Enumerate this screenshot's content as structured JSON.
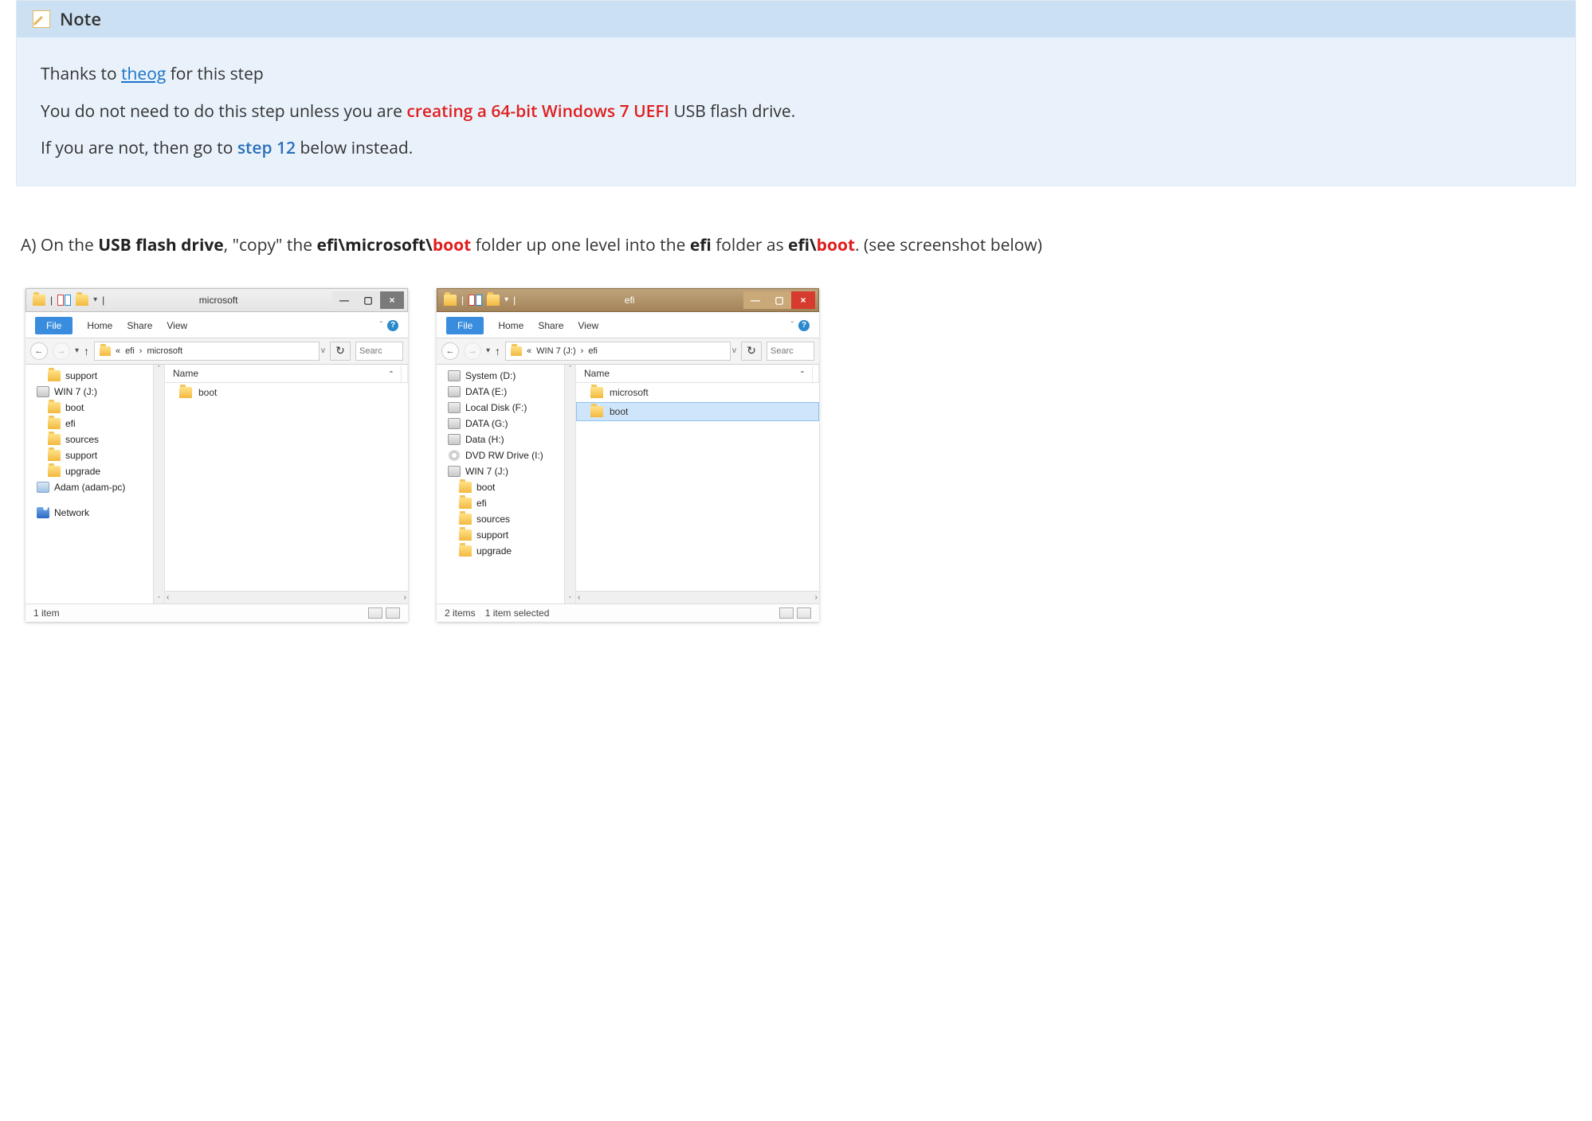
{
  "note": {
    "heading": "Note",
    "thanks_prefix": "Thanks to ",
    "thanks_link": "theog",
    "thanks_suffix": " for this step",
    "line2_pre": "You do not need to do this step unless you are ",
    "line2_emph": "creating a 64-bit Windows 7 UEFI",
    "line2_post": " USB flash drive.",
    "line3_pre": "If you are not, then go to ",
    "line3_step": "step 12",
    "line3_post": " below instead."
  },
  "instruction": {
    "pre": "A) On the ",
    "b1": "USB flash drive",
    "mid1": ", \"copy\" the ",
    "b2": "efi\\microsoft\\",
    "red1": "boot",
    "mid2": " folder up one level into the ",
    "b3": "efi",
    "mid3": " folder as ",
    "b4": "efi\\",
    "red2": "boot",
    "post": ". (see screenshot below)"
  },
  "left": {
    "title": "microsoft",
    "tabs": {
      "file": "File",
      "home": "Home",
      "share": "Share",
      "view": "View"
    },
    "breadcrumb": [
      "«",
      "efi",
      "›",
      "microsoft"
    ],
    "search": "Searc",
    "nav": [
      "support",
      "WIN 7 (J:)",
      "boot",
      "efi",
      "sources",
      "support",
      "upgrade",
      "Adam (adam-pc)",
      "",
      "Network"
    ],
    "col_name": "Name",
    "items": [
      "boot"
    ],
    "status": "1 item"
  },
  "right": {
    "title": "efi",
    "tabs": {
      "file": "File",
      "home": "Home",
      "share": "Share",
      "view": "View"
    },
    "breadcrumb": [
      "«",
      "WIN 7 (J:)",
      "›",
      "efi"
    ],
    "search": "Searc",
    "nav": [
      "System (D:)",
      "DATA (E:)",
      "Local Disk (F:)",
      "DATA (G:)",
      "Data (H:)",
      "DVD RW Drive (I:)",
      "WIN 7 (J:)",
      "boot",
      "efi",
      "sources",
      "support",
      "upgrade"
    ],
    "col_name": "Name",
    "items": [
      "microsoft",
      "boot"
    ],
    "status_count": "2 items",
    "status_sel": "1 item selected"
  },
  "glyphs": {
    "min": "—",
    "max": "▢",
    "close": "×",
    "back": "←",
    "forward": "→",
    "up": "↑",
    "caret": "▾",
    "refresh": "↻",
    "chev_r": "›",
    "chev_l": "‹",
    "chev_up": "ˆ",
    "chev_dn": "ˇ",
    "help": "?",
    "pipe": "|",
    "bcdrop": "v"
  }
}
